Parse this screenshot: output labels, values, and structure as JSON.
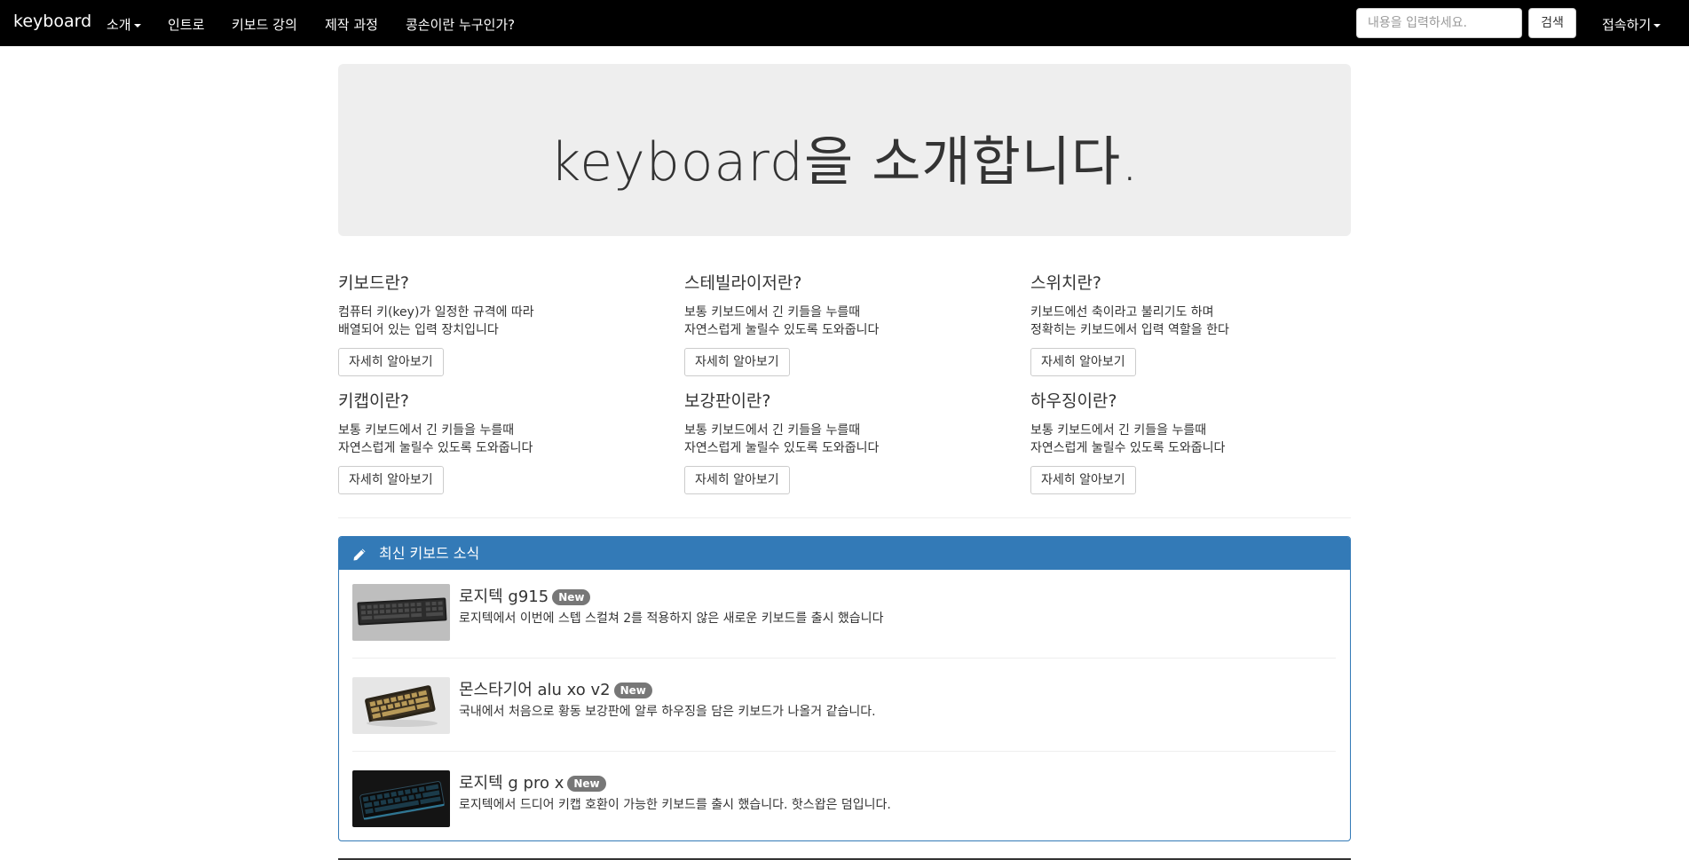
{
  "navbar": {
    "brand": "keyboard",
    "items": [
      {
        "label": "소개",
        "dropdown": true
      },
      {
        "label": "인트로"
      },
      {
        "label": "키보드 강의"
      },
      {
        "label": "제작 과정"
      },
      {
        "label": "콩손이란 누구인가?"
      }
    ],
    "search": {
      "placeholder": "내용을 입력하세요.",
      "button": "검색"
    },
    "connect": {
      "label": "접속하기",
      "dropdown": true
    }
  },
  "jumbotron": {
    "title": "keyboard을 소개합니다."
  },
  "features": [
    {
      "title": "키보드란?",
      "lines": [
        "컴퓨터 키(key)가 일정한 규격에 따라",
        "배열되어 있는 입력 장치입니다"
      ],
      "button": "자세히 알아보기"
    },
    {
      "title": "스테빌라이저란?",
      "lines": [
        "보통 키보드에서 긴 키들을 누를때",
        "자연스럽게 눌릴수 있도록 도와줍니다"
      ],
      "button": "자세히 알아보기"
    },
    {
      "title": "스위치란?",
      "lines": [
        "키보드에선 축이라고 불리기도 하며",
        "정확히는 키보드에서 입력 역할을 한다"
      ],
      "button": "자세히 알아보기"
    },
    {
      "title": "키캡이란?",
      "lines": [
        "보통 키보드에서 긴 키들을 누를때",
        "자연스럽게 눌릴수 있도록 도와줍니다"
      ],
      "button": "자세히 알아보기"
    },
    {
      "title": "보강판이란?",
      "lines": [
        "보통 키보드에서 긴 키들을 누를때",
        "자연스럽게 눌릴수 있도록 도와줍니다"
      ],
      "button": "자세히 알아보기"
    },
    {
      "title": "하우징이란?",
      "lines": [
        "보통 키보드에서 긴 키들을 누를때",
        "자연스럽게 눌릴수 있도록 도와줍니다"
      ],
      "button": "자세히 알아보기"
    }
  ],
  "news": {
    "heading": "최신 키보드 소식",
    "heading_icon": "pencil-icon",
    "items": [
      {
        "title": "로지텍 g915",
        "badge": "New",
        "desc": "로지텍에서 이번에 스텝 스컬쳐 2를 적용하지 않은 새로운 키보드를 출시 했습니다"
      },
      {
        "title": "몬스타기어 alu xo v2",
        "badge": "New",
        "desc": "국내에서 처음으로 황동 보강판에 알루 하우징을 담은 키보드가 나올거 같습니다."
      },
      {
        "title": "로지텍 g pro x",
        "badge": "New",
        "desc": "로지텍에서 드디어 키캡 호환이 가능한 키보드를 출시 했습니다. 핫스왑은 덤입니다."
      }
    ]
  },
  "colors": {
    "navbar": "#000000",
    "panel": "#337ab7",
    "jumbotron": "#eeeeee",
    "badge": "#777777"
  }
}
